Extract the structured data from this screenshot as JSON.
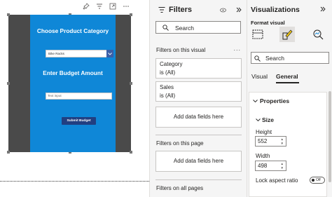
{
  "canvas": {
    "app": {
      "category_heading": "Choose Product Category",
      "category_value": "Bike Racks",
      "budget_heading": "Enter Budget Amount",
      "budget_placeholder": "Text input",
      "submit_label": "Submit Budget"
    }
  },
  "filters": {
    "title": "Filters",
    "search_placeholder": "Search",
    "on_visual_label": "Filters on this visual",
    "category_card": {
      "field": "Category",
      "state": "is (All)"
    },
    "sales_card": {
      "field": "Sales",
      "state": "is (All)"
    },
    "add_fields_label": "Add data fields here",
    "on_page_label": "Filters on this page",
    "add_fields_label_2": "Add data fields here",
    "on_all_pages_label": "Filters on all pages",
    "more_glyph": "..."
  },
  "visualizations": {
    "title": "Visualizations",
    "format_visual_label": "Format visual",
    "search_placeholder": "Search",
    "tabs": [
      "Visual",
      "General"
    ],
    "active_tab": "General",
    "properties_label": "Properties",
    "size_label": "Size",
    "height_label": "Height",
    "height_value": "552",
    "width_label": "Width",
    "width_value": "498",
    "lock_aspect_label": "Lock aspect ratio",
    "lock_toggle_text": "Off"
  },
  "colors": {
    "app_background": "#0f87d7",
    "submit_button": "#213f81",
    "visual_frame": "#4a4a4a",
    "pane_background": "#f5f5f5"
  }
}
